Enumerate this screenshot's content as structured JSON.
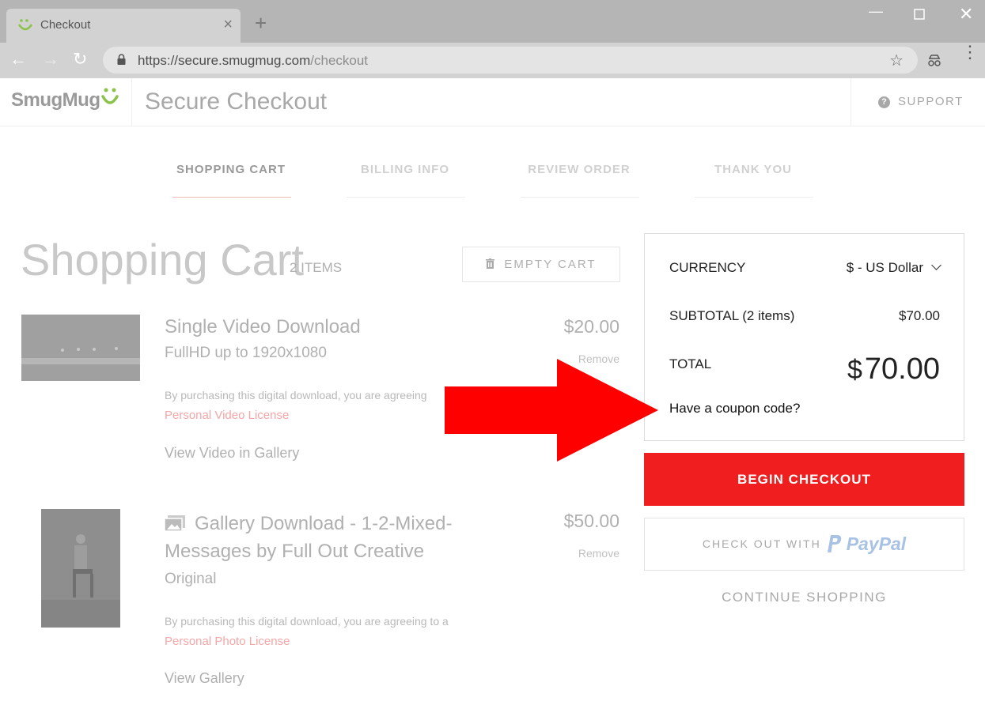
{
  "browser": {
    "tab_title": "Checkout",
    "url_host": "https://secure.smugmug.com",
    "url_path": "/checkout"
  },
  "header": {
    "logo_text": "SmugMug",
    "title": "Secure Checkout",
    "support_label": "SUPPORT"
  },
  "steps": [
    {
      "label": "SHOPPING CART",
      "active": true
    },
    {
      "label": "BILLING INFO",
      "active": false
    },
    {
      "label": "REVIEW ORDER",
      "active": false
    },
    {
      "label": "THANK YOU",
      "active": false
    }
  ],
  "cart": {
    "title": "Shopping Cart",
    "count": "2 ITEMS",
    "empty_label": "EMPTY CART",
    "items": [
      {
        "name": "Single Video Download",
        "subtitle": "FullHD up to 1920x1080",
        "price": "$20.00",
        "remove": "Remove",
        "note": "By purchasing this digital download, you are agreeing",
        "license": "Personal Video License",
        "view_link": "View Video in Gallery"
      },
      {
        "name_line1": "Gallery Download - 1-2-Mixed-",
        "name_line2": "Messages by Full Out Creative",
        "subtitle": "Original",
        "price": "$50.00",
        "remove": "Remove",
        "note": "By purchasing this digital download, you are agreeing to a",
        "license": "Personal Photo License",
        "view_link": "View Gallery"
      }
    ]
  },
  "summary": {
    "currency_label": "CURRENCY",
    "currency_value": "$ - US Dollar",
    "subtotal_label": "SUBTOTAL (2 items)",
    "subtotal_value": "$70.00",
    "total_label": "TOTAL",
    "total_symbol": "$",
    "total_value": "70.00",
    "coupon_link": "Have a coupon code?",
    "begin_checkout": "BEGIN CHECKOUT",
    "paypal_prefix": "CHECK OUT WITH",
    "paypal_brand": "PayPal",
    "continue_shopping": "CONTINUE SHOPPING"
  },
  "colors": {
    "accent": "#f01e1e",
    "arrow": "#ff0000",
    "step_active": "#999999",
    "step_inactive": "#cfcfcf"
  }
}
